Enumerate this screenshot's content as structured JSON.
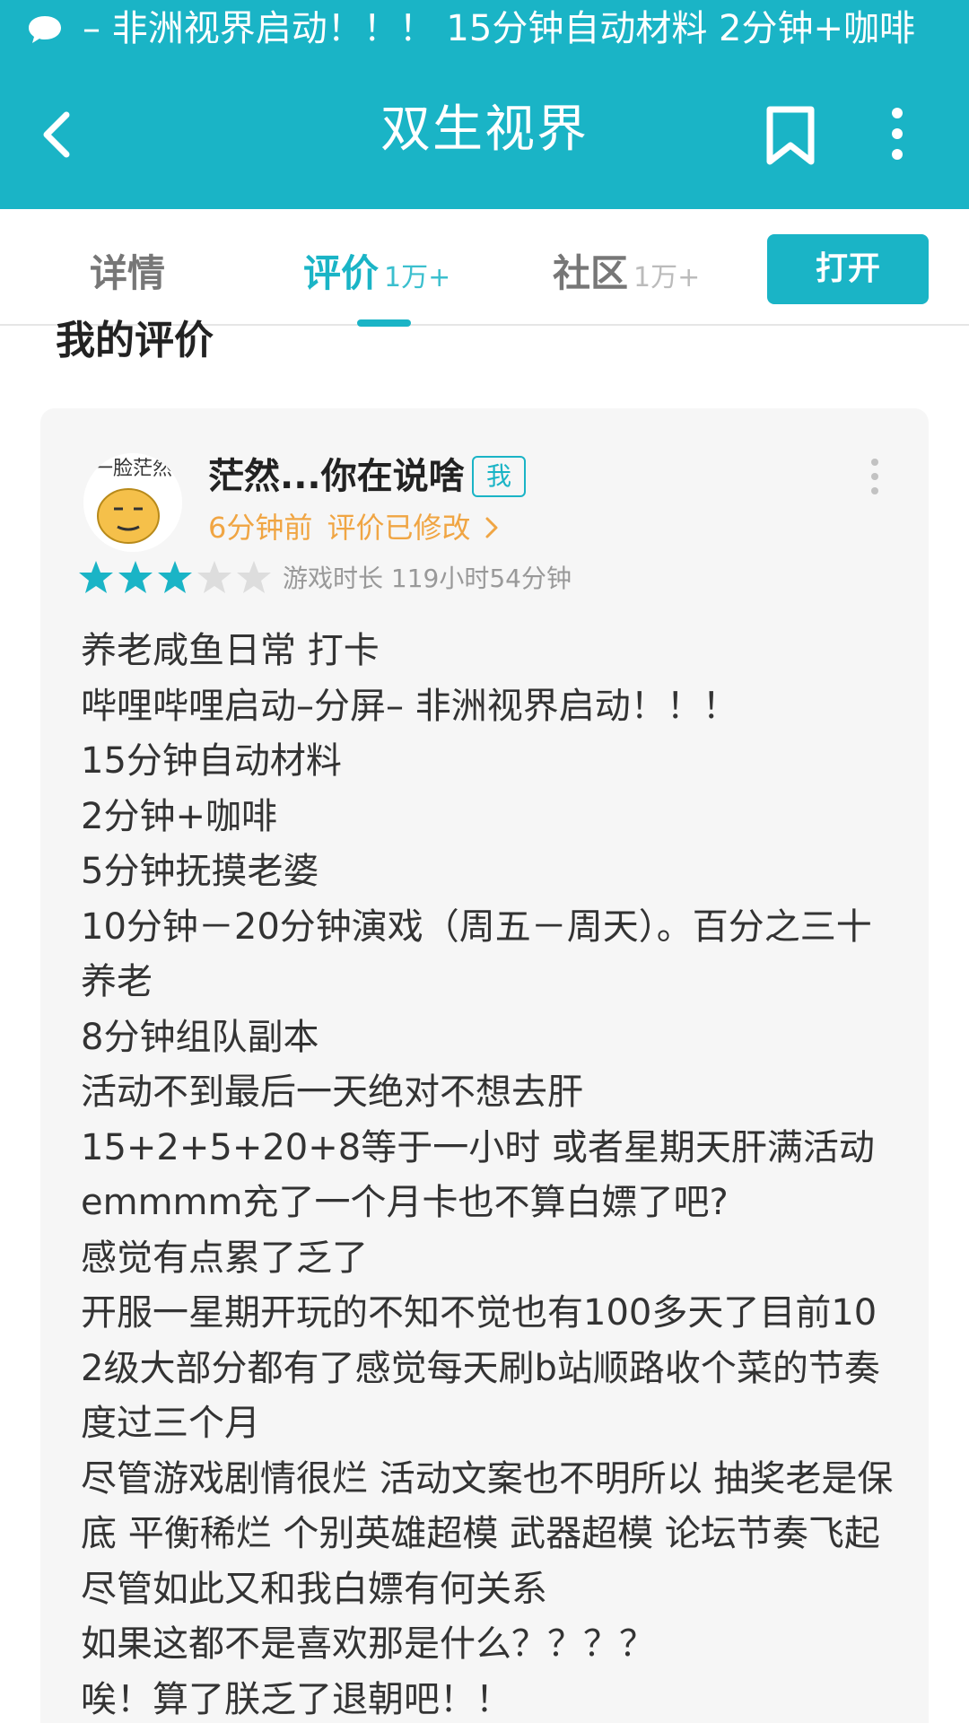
{
  "status_bar": {
    "icon": "chat-bubble-icon",
    "ticker_text": "– 非洲视界启动！！！  15分钟自动材料  2分钟+咖啡"
  },
  "app_bar": {
    "title": "双生视界",
    "back_icon": "back-arrow-icon",
    "bookmark_icon": "bookmark-icon",
    "more_icon": "more-vertical-icon"
  },
  "tabs": [
    {
      "label": "详情",
      "count": ""
    },
    {
      "label": "评价",
      "count": "1万+",
      "active": true
    },
    {
      "label": "社区",
      "count": "1万+"
    }
  ],
  "open_button": "打开",
  "section_title": "我的评价",
  "review_card": {
    "avatar_text": "一脸茫然",
    "username": "茫然...你在说啥",
    "badge": "我",
    "time": "6分钟前",
    "edited": "评价已修改",
    "rating": 3,
    "rating_max": 5,
    "playtime": "游戏时长 119小时54分钟",
    "lines": [
      "养老咸鱼日常 打卡",
      "哔哩哔哩启动–分屏– 非洲视界启动！！！",
      "15分钟自动材料",
      "2分钟+咖啡",
      "5分钟抚摸老婆",
      "10分钟－20分钟演戏（周五－周天）。百分之三十养老",
      "8分钟组队副本",
      "活动不到最后一天绝对不想去肝",
      "15+2+5+20+8等于一小时 或者星期天肝满活动",
      "emmmm充了一个月卡也不算白嫖了吧?",
      "感觉有点累了乏了",
      "开服一星期开玩的不知不觉也有100多天了目前102级大部分都有了感觉每天刷b站顺路收个菜的节奏度过三个月",
      "尽管游戏剧情很烂 活动文案也不明所以 抽奖老是保底 平衡稀烂 个别英雄超模 武器超模 论坛节奏飞起 尽管如此又和我白嫖有何关系",
      "如果这都不是喜欢那是什么？？？？",
      "唉！算了朕乏了退朝吧！！"
    ]
  },
  "colors": {
    "accent": "#1ab4c6",
    "orange": "#f0a543",
    "card_bg": "#f6f6f6",
    "star_off": "#dddddd"
  }
}
